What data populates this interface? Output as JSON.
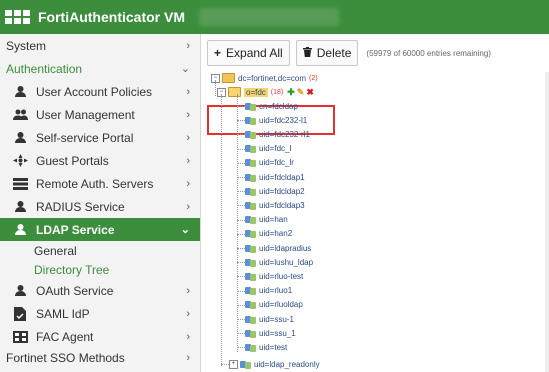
{
  "app": {
    "title": "FortiAuthenticator VM"
  },
  "sidebar": {
    "system": "System",
    "authentication": "Authentication",
    "items": [
      {
        "label": "User Account Policies",
        "icon": "user-account-policies-icon"
      },
      {
        "label": "User Management",
        "icon": "users-icon"
      },
      {
        "label": "Self-service Portal",
        "icon": "self-service-icon"
      },
      {
        "label": "Guest Portals",
        "icon": "guest-portals-icon"
      },
      {
        "label": "Remote Auth. Servers",
        "icon": "remote-auth-icon"
      },
      {
        "label": "RADIUS Service",
        "icon": "radius-icon"
      },
      {
        "label": "LDAP Service",
        "icon": "ldap-icon"
      },
      {
        "label": "OAuth Service",
        "icon": "oauth-icon"
      },
      {
        "label": "SAML IdP",
        "icon": "saml-icon"
      },
      {
        "label": "FAC Agent",
        "icon": "fac-agent-icon"
      }
    ],
    "ldap_sub": {
      "general": "General",
      "directory_tree": "Directory Tree"
    },
    "fortinet_sso": "Fortinet SSO Methods"
  },
  "toolbar": {
    "expand_all": "Expand All",
    "delete": "Delete",
    "entries": "(59979 of 60000 entries remaining)"
  },
  "tree": {
    "root": {
      "label": "dc=fortinet,dc=com",
      "count": "(2)"
    },
    "org": {
      "label": "o=fdc",
      "count": "(18)"
    },
    "children": [
      "cn=fdcldap",
      "uid=fdc232-l1",
      "uid=fdc232-rl1",
      "uid=fdc_l",
      "uid=fdc_lr",
      "uid=fdcldap1",
      "uid=fdcldap2",
      "uid=fdcldap3",
      "uid=han",
      "uid=han2",
      "uid=ldapradius",
      "uid=lushu_ldap",
      "uid=rluo-test",
      "uid=rluo1",
      "uid=rluoldap",
      "uid=ssu-1",
      "uid=ssu_1",
      "uid=test"
    ],
    "last": "uid=ldap_readonly"
  },
  "colors": {
    "brand_green": "#3c8d3c",
    "highlight_red": "#e53030"
  }
}
